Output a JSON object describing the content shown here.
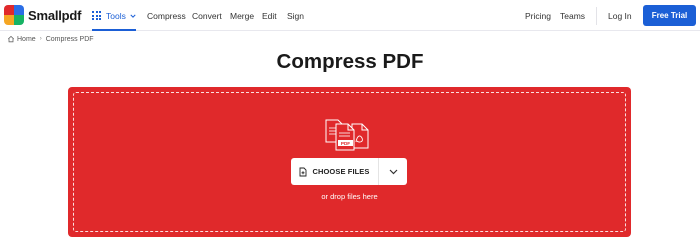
{
  "header": {
    "brand": "Smallpdf",
    "logo_colors": [
      "#e0292b",
      "#2b6ee6",
      "#f5a623",
      "#16b364"
    ],
    "tools_label": "Tools",
    "nav": [
      "Compress",
      "Convert",
      "Merge",
      "Edit",
      "Sign"
    ],
    "pricing": "Pricing",
    "teams": "Teams",
    "login": "Log In",
    "trial": "Free Trial"
  },
  "breadcrumb": {
    "home": "Home",
    "current": "Compress PDF"
  },
  "page": {
    "title": "Compress PDF"
  },
  "dropzone": {
    "choose_label": "CHOOSE FILES",
    "drop_text": "or drop files here",
    "file_badge": "PDF",
    "accent": "#e0292b"
  },
  "colors": {
    "accent_blue": "#1b5fd6",
    "dropzone_red": "#e0292b"
  }
}
